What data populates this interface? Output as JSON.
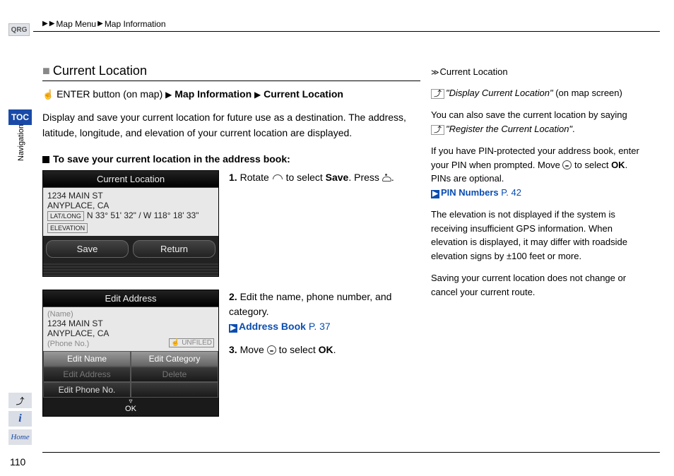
{
  "breadcrumb": {
    "item1": "Map Menu",
    "item2": "Map Information"
  },
  "sidebar": {
    "qrg": "QRG",
    "toc": "TOC",
    "nav": "Navigation",
    "home": "Home",
    "info": "i",
    "voice": "⤴"
  },
  "section": {
    "title": "Current Location",
    "path_pre": "ENTER button (on map)",
    "path_mid": "Map Information",
    "path_end": "Current Location",
    "description": "Display and save your current location for future use as a destination. The address, latitude, longitude, and elevation of your current location are displayed.",
    "subhead": "To save your current location in the address book:"
  },
  "steps": {
    "s1": {
      "num": "1.",
      "a": "Rotate ",
      "b": " to select ",
      "save": "Save",
      "c": ". Press ",
      "d": "."
    },
    "s2": {
      "num": "2.",
      "text": "Edit the name, phone number, and category.",
      "link_label": "Address Book",
      "link_page": "P. 37"
    },
    "s3": {
      "num": "3.",
      "a": "Move ",
      "b": " to select ",
      "ok": "OK",
      "c": "."
    }
  },
  "shot1": {
    "title": "Current Location",
    "addr1": "1234 MAIN ST",
    "addr2": "ANYPLACE, CA",
    "latlabel": "LAT/LONG",
    "lat": "N 33° 51' 32\" / W 118° 18' 33\"",
    "elevlabel": "ELEVATION",
    "btn_save": "Save",
    "btn_return": "Return"
  },
  "shot2": {
    "title": "Edit Address",
    "name_label": "(Name)",
    "addr1": "1234 MAIN ST",
    "addr2": "ANYPLACE, CA",
    "phone_label": "(Phone No.)",
    "unfiled": "UNFILED",
    "b1": "Edit Name",
    "b2": "Edit Category",
    "b3": "Edit Address",
    "b4": "Delete",
    "b5": "Edit Phone No.",
    "ok": "OK"
  },
  "right": {
    "title": "Current Location",
    "p1a": "\"Display Current Location\"",
    "p1b": " (on map screen)",
    "p2a": "You can also save the current location by saying ",
    "p2b": "\"Register the Current Location\"",
    "p2c": ".",
    "p3a": "If you have PIN-protected your address book, enter your PIN when prompted. Move ",
    "p3b": " to select ",
    "p3ok": "OK",
    "p3c": ". PINs are optional.",
    "p3link_label": "PIN Numbers",
    "p3link_page": "P. 42",
    "p4": "The elevation is not displayed if the system is receiving insufficient GPS information. When elevation is displayed, it may differ with roadside elevation signs by ±100 feet or more.",
    "p5": "Saving your current location does not change or cancel your current route."
  },
  "page_number": "110"
}
